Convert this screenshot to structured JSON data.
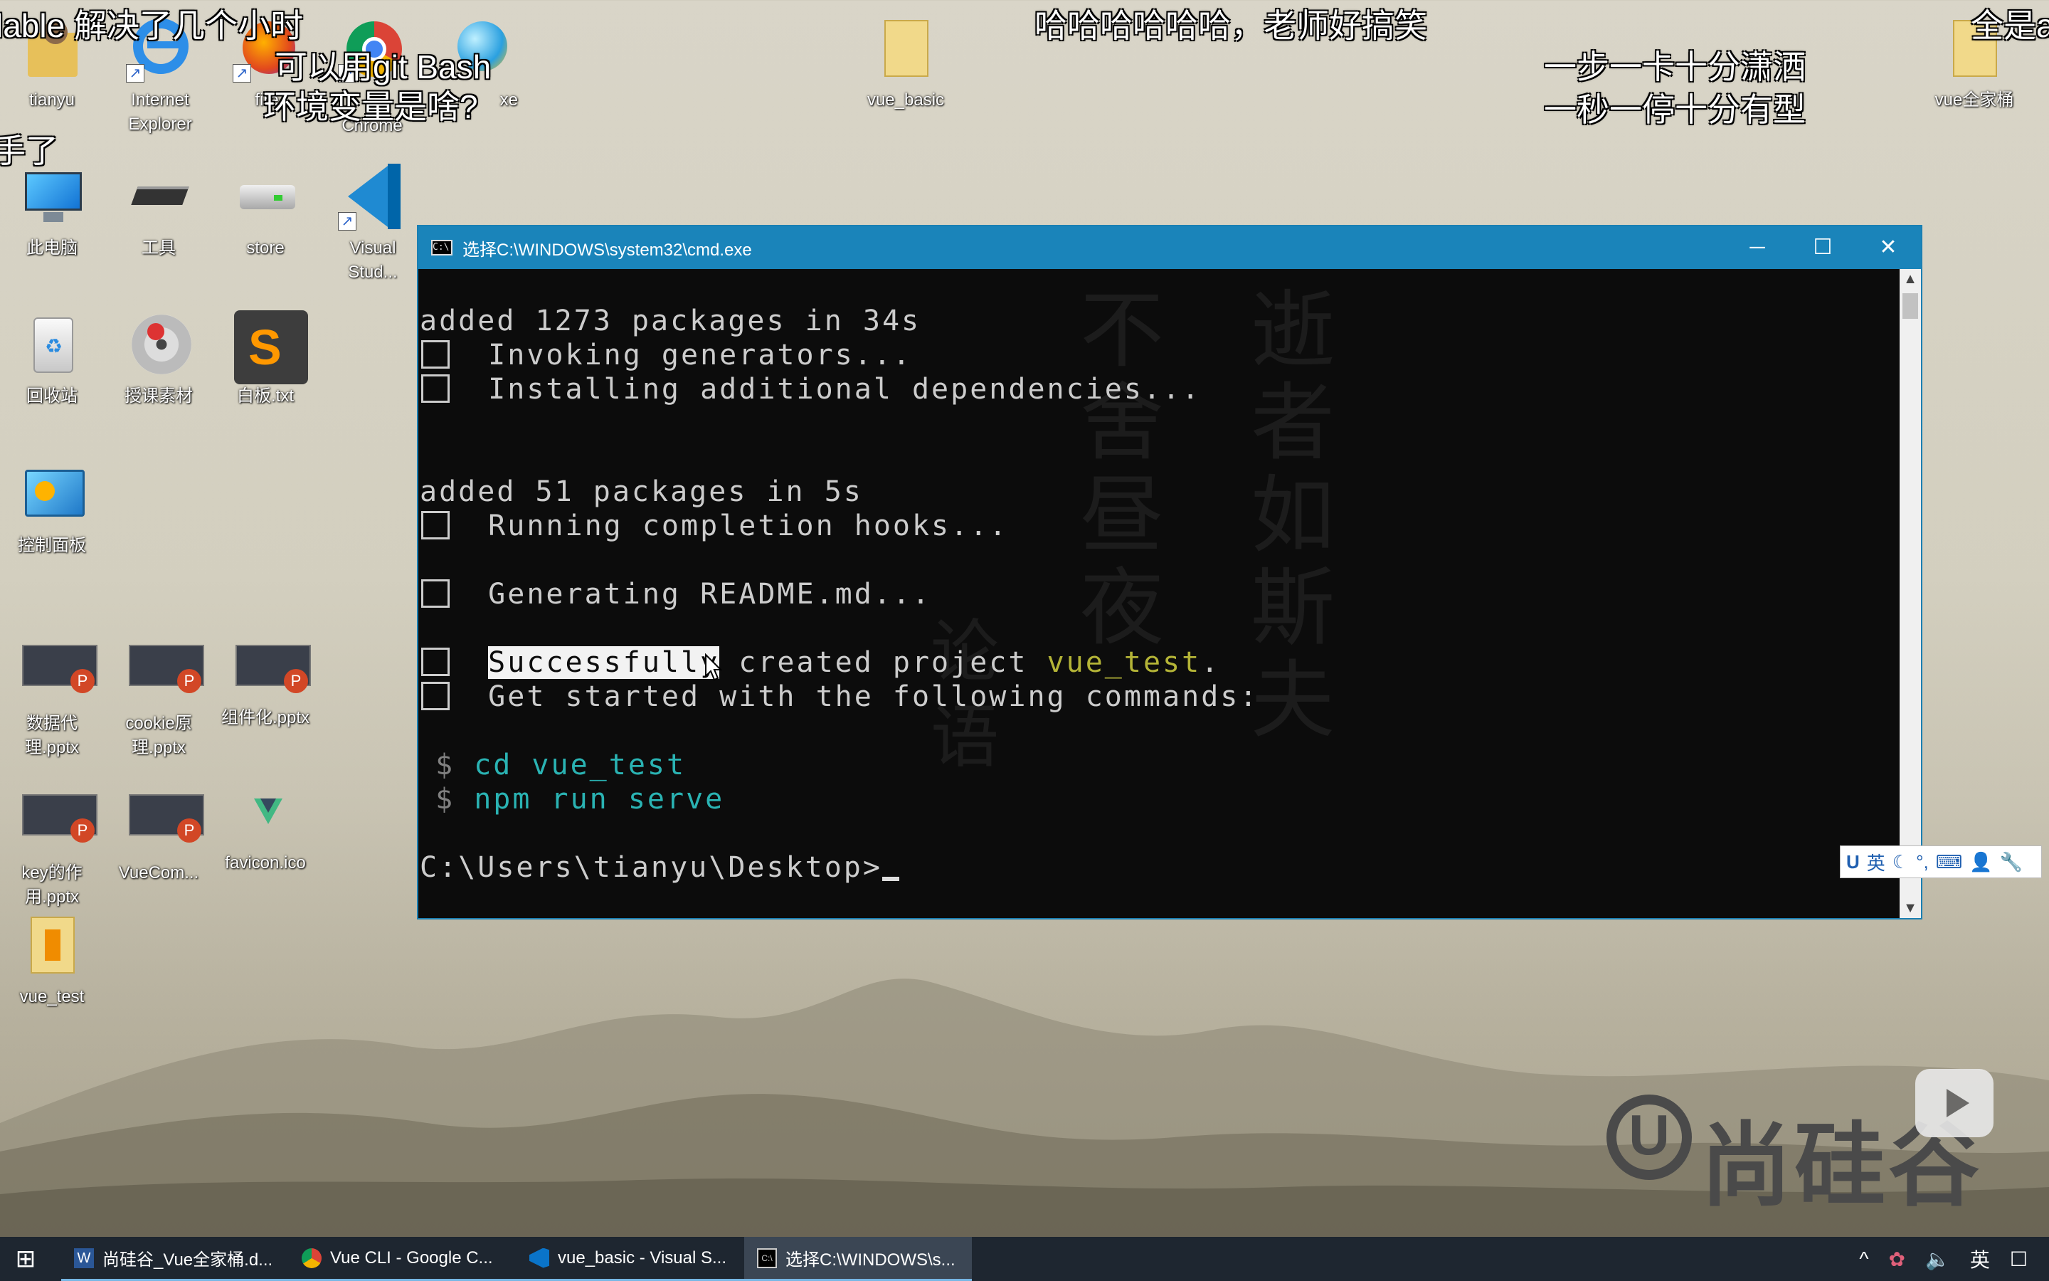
{
  "danmaku": [
    "lable 解决了几个小时",
    "哈哈哈哈哈哈，老师好搞笑",
    "全是ap",
    "可以用git Bash",
    "环境变量是啥?",
    "一步一卡十分潇洒",
    "一秒一停十分有型",
    "手了"
  ],
  "desktop_icons": [
    {
      "label": "tianyu",
      "icon": "user-folder-icon"
    },
    {
      "label": "Internet Explorer",
      "icon": "internet-explorer-icon"
    },
    {
      "label": "fire",
      "icon": "firefox-icon"
    },
    {
      "label": "Chrome",
      "icon": "chrome-icon"
    },
    {
      "label": "xe",
      "icon": "exe-icon"
    },
    {
      "label": "vue_basic",
      "icon": "folder-icon"
    },
    {
      "label": "vue全家桶",
      "icon": "folder-icon"
    },
    {
      "label": "此电脑",
      "icon": "computer-icon"
    },
    {
      "label": "工具",
      "icon": "tools-icon"
    },
    {
      "label": "store",
      "icon": "store-icon"
    },
    {
      "label": "Visual Stud...",
      "icon": "vscode-icon"
    },
    {
      "label": "回收站",
      "icon": "recycle-bin-icon"
    },
    {
      "label": "授课素材",
      "icon": "cd-icon"
    },
    {
      "label": "白板.txt",
      "icon": "sublime-icon"
    },
    {
      "label": "控制面板",
      "icon": "control-panel-icon"
    },
    {
      "label": "数据代理.pptx",
      "icon": "pptx-icon"
    },
    {
      "label": "cookie原理.pptx",
      "icon": "pptx-icon"
    },
    {
      "label": "组件化.pptx",
      "icon": "pptx-icon"
    },
    {
      "label": "key的作用.pptx",
      "icon": "pptx-icon"
    },
    {
      "label": "VueCom...",
      "icon": "pptx-icon"
    },
    {
      "label": "favicon.ico",
      "icon": "vue-logo-icon"
    },
    {
      "label": "vue_test",
      "icon": "folder-icon"
    }
  ],
  "cmd_window": {
    "title": "选择C:\\WINDOWS\\system32\\cmd.exe",
    "minimize": "─",
    "maximize": "☐",
    "close": "✕",
    "lines": [
      "added 1273 packages in 34s",
      "Invoking generators...",
      "Installing additional dependencies...",
      "added 51 packages in 5s",
      "Running completion hooks...",
      "Generating README.md...",
      "Successfully",
      " created project ",
      "vue_test",
      ".",
      "Get started with the following commands:",
      "$",
      "cd vue_test",
      "$",
      "npm run serve",
      "C:\\Users\\tianyu\\Desktop>"
    ],
    "wallpaper_calligraphy": [
      "逝",
      "者",
      "如",
      "斯",
      "夫",
      "不",
      "舍",
      "昼",
      "夜",
      "论",
      "语"
    ]
  },
  "ime_bar": {
    "lang": "英",
    "logo": "U"
  },
  "watermark": {
    "brand": "尚硅谷",
    "logo": "U"
  },
  "taskbar": {
    "start": "⊞",
    "tasks": [
      {
        "label": "尚硅谷_Vue全家桶.d...",
        "icon": "word-icon",
        "color": "#2b5797"
      },
      {
        "label": "Vue CLI - Google C...",
        "icon": "chrome-icon",
        "color": "#db4437"
      },
      {
        "label": "vue_basic - Visual S...",
        "icon": "vscode-icon",
        "color": "#0a74c9"
      },
      {
        "label": "选择C:\\WINDOWS\\s...",
        "icon": "cmd-icon",
        "color": "#000000"
      }
    ],
    "tray": {
      "chevron": "^",
      "volume": "🔈",
      "lang": "英",
      "notification": "☐"
    }
  },
  "colors": {
    "cmd_title": "#1a84ba",
    "console_bg": "#0c0c0c",
    "console_text": "#cccccc",
    "project_name": "#b4b437",
    "command": "#2ab3b3",
    "taskbar": "#1e2630"
  }
}
